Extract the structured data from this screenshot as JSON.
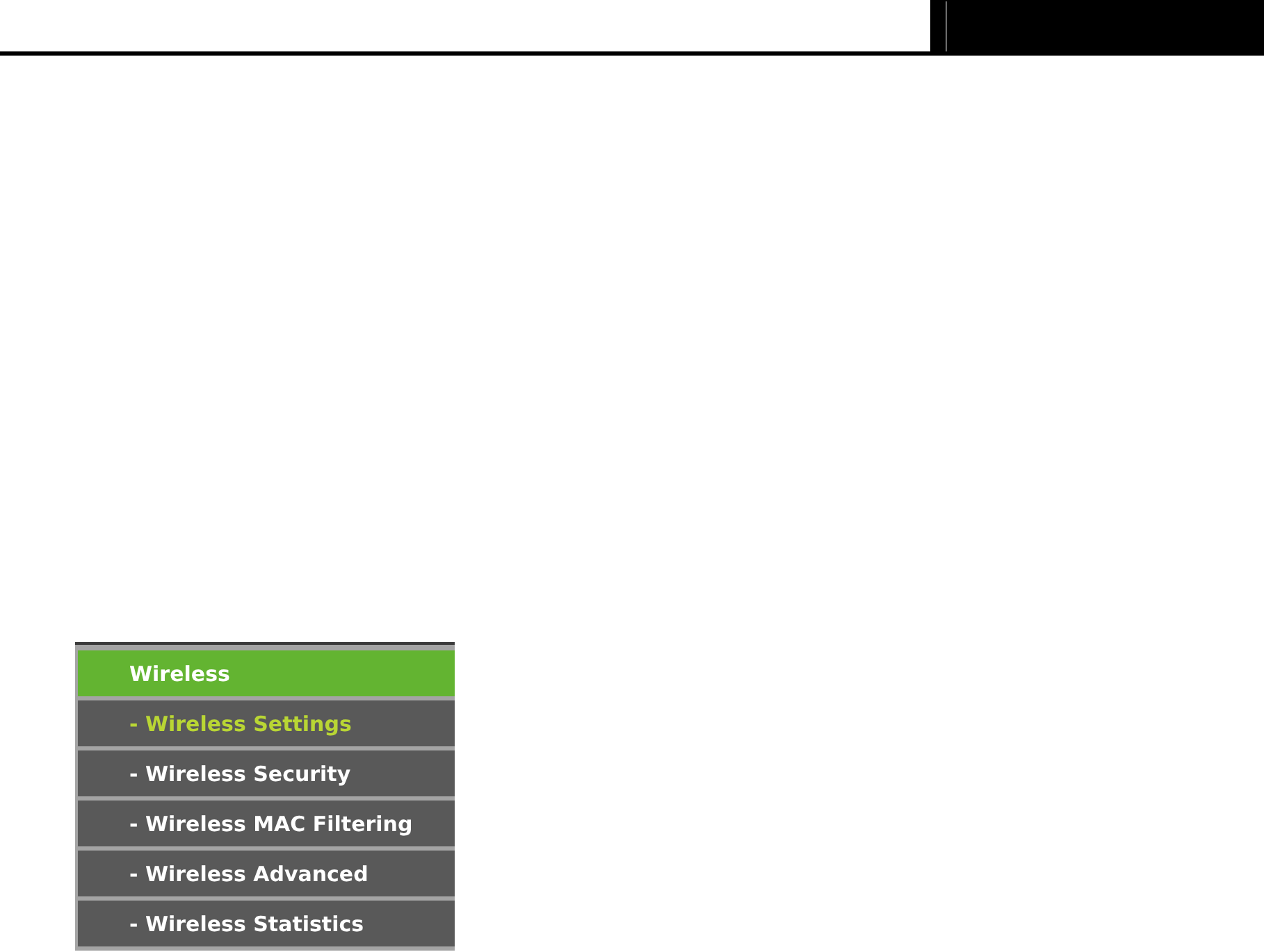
{
  "menu": {
    "title": "Wireless",
    "items": [
      {
        "label": "- Wireless Settings",
        "selected": true
      },
      {
        "label": "- Wireless Security",
        "selected": false
      },
      {
        "label": "- Wireless MAC Filtering",
        "selected": false
      },
      {
        "label": "- Wireless Advanced",
        "selected": false
      },
      {
        "label": "- Wireless Statistics",
        "selected": false
      }
    ]
  }
}
